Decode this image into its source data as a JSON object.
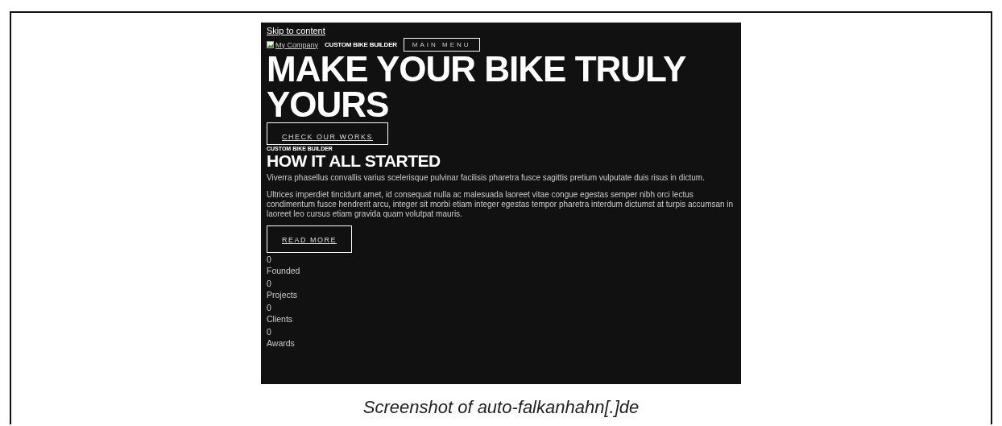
{
  "skip_link": "Skip to content",
  "logo": {
    "alt": "My Company"
  },
  "tagline_top": "CUSTOM BIKE BUILDER",
  "menu_button": "MAIN MENU",
  "hero": {
    "title": "MAKE YOUR BIKE TRULY YOURS",
    "button": "CHECK OUR WORKS"
  },
  "about": {
    "eyebrow": "CUSTOM BIKE BUILDER",
    "title": "HOW IT ALL STARTED",
    "paragraphs": [
      "Viverra phasellus convallis varius scelerisque pulvinar facilisis pharetra fusce sagittis pretium vulputate duis risus in dictum.",
      "Ultrices imperdiet tincidunt amet, id consequat nulla ac malesuada laoreet vitae congue egestas semper nibh orci lectus condimentum fusce hendrerit arcu, integer sit morbi etiam integer egestas tempor pharetra interdum dictumst at turpis accumsan in laoreet leo cursus etiam gravida quam volutpat mauris."
    ],
    "button": "READ MORE"
  },
  "stats": [
    {
      "value": "0",
      "label": "Founded"
    },
    {
      "value": "0",
      "label": "Projects"
    },
    {
      "value": "0",
      "label": "Clients"
    },
    {
      "value": "0",
      "label": "Awards"
    }
  ],
  "caption": "Screenshot of auto-falkanhahn[.]de"
}
